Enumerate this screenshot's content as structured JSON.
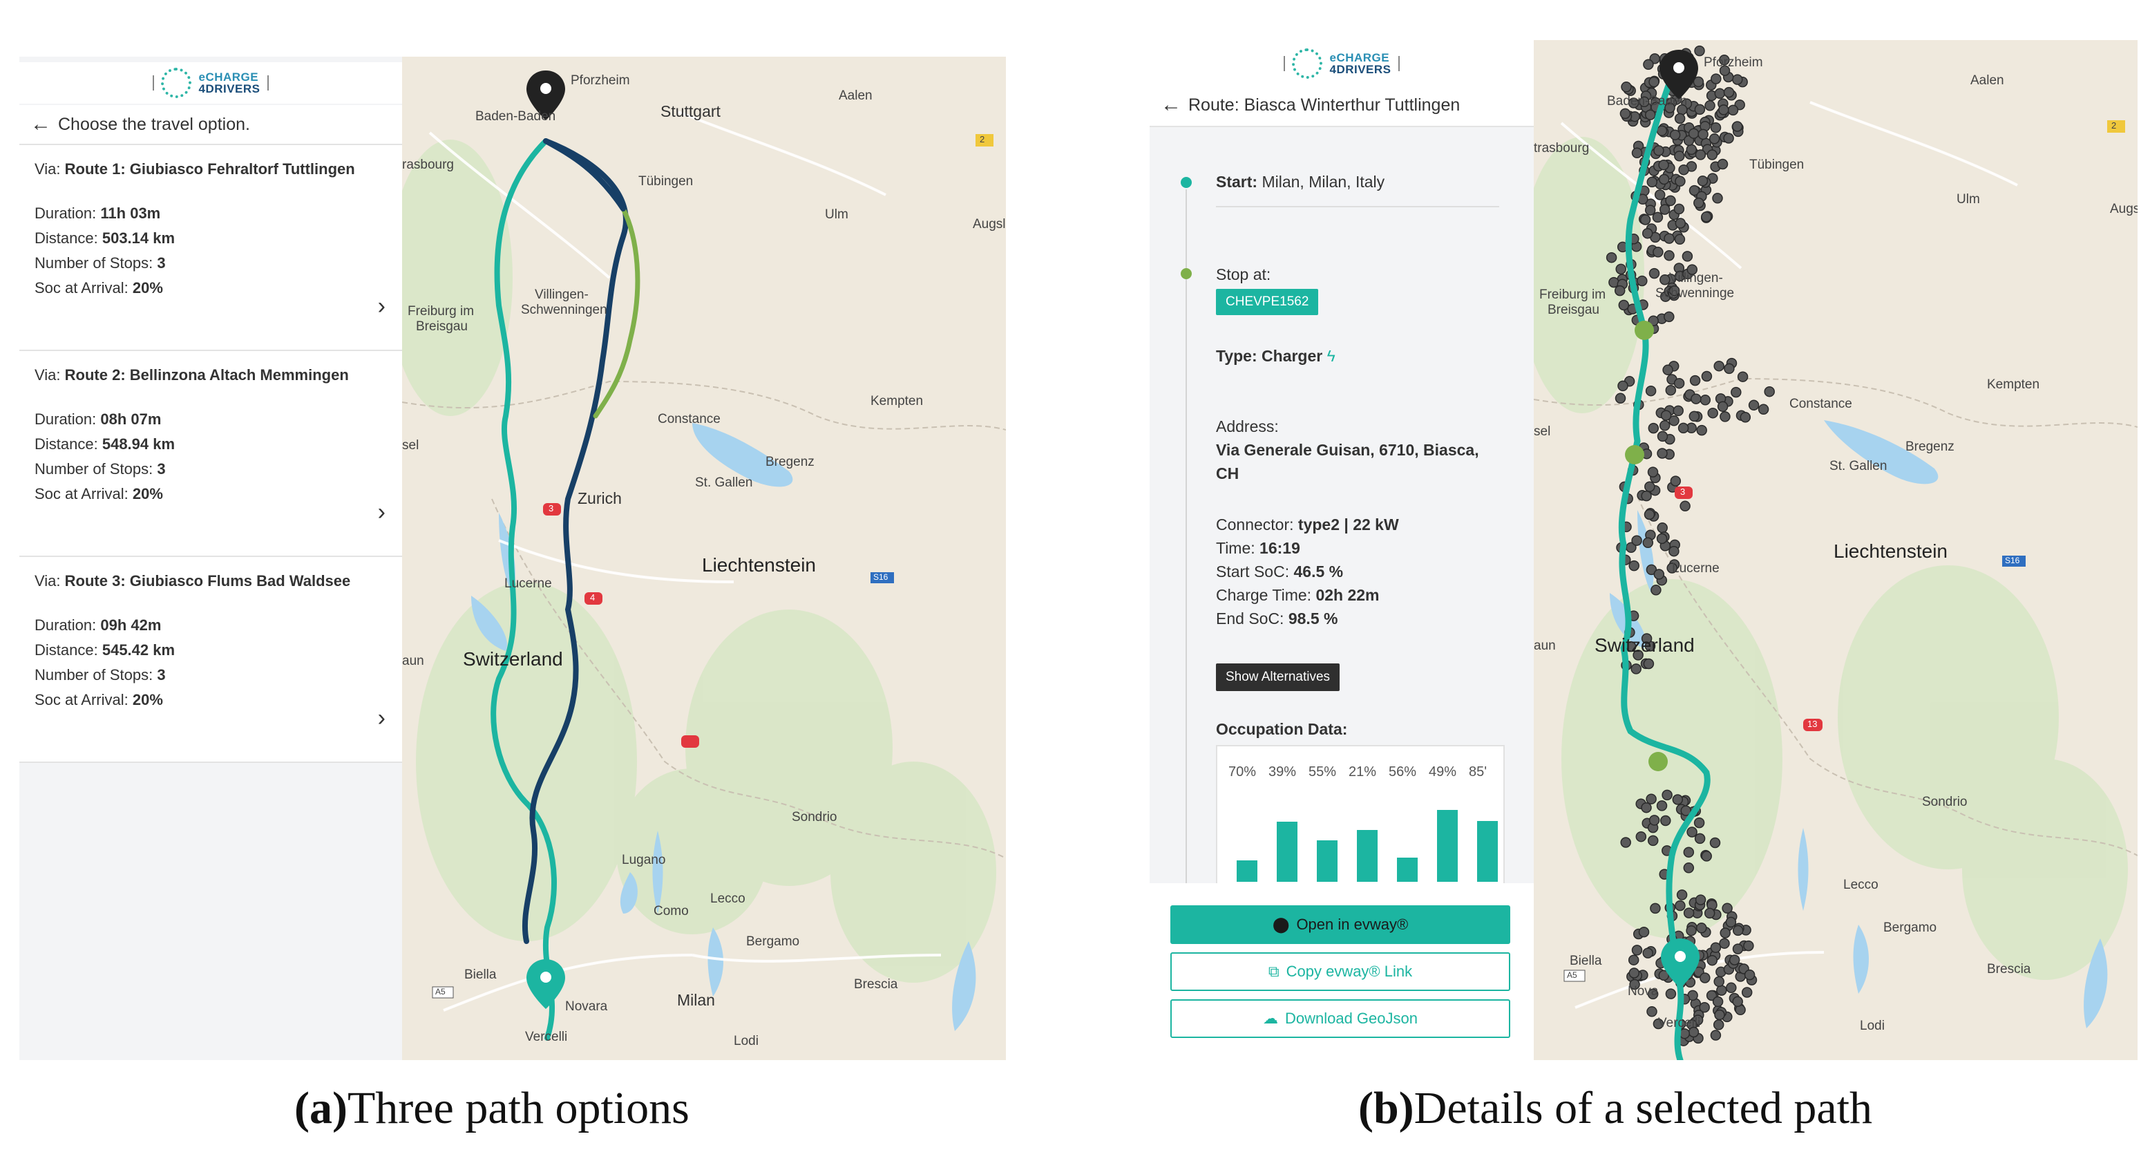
{
  "logo": {
    "line1": "eCHARGE",
    "line2": "4DRIVERS"
  },
  "panel_a": {
    "back_icon": "arrow-left-icon",
    "title": "Choose the travel option.",
    "routes": [
      {
        "via_prefix": "Via:",
        "name": "Route 1: Giubiasco Fehraltorf Tuttlingen",
        "duration_label": "Duration:",
        "duration": "11h 03m",
        "distance_label": "Distance:",
        "distance": "503.14 km",
        "stops_label": "Number of Stops:",
        "stops": "3",
        "soc_label": "Soc at Arrival:",
        "soc": "20%"
      },
      {
        "via_prefix": "Via:",
        "name": "Route 2: Bellinzona Altach Memmingen",
        "duration_label": "Duration:",
        "duration": "08h 07m",
        "distance_label": "Distance:",
        "distance": "548.94 km",
        "stops_label": "Number of Stops:",
        "stops": "3",
        "soc_label": "Soc at Arrival:",
        "soc": "20%"
      },
      {
        "via_prefix": "Via:",
        "name": "Route 3: Giubiasco Flums Bad Waldsee",
        "duration_label": "Duration:",
        "duration": "09h 42m",
        "distance_label": "Distance:",
        "distance": "545.42 km",
        "stops_label": "Number of Stops:",
        "stops": "3",
        "soc_label": "Soc at Arrival:",
        "soc": "20%"
      }
    ]
  },
  "panel_b": {
    "route_title": "Route: Biasca Winterthur Tuttlingen",
    "start_label": "Start:",
    "start_value": "Milan, Milan, Italy",
    "stop_label": "Stop at:",
    "stop_id": "CHEVPE1562",
    "type_label": "Type:",
    "type_value": "Charger",
    "address_label": "Address:",
    "address_line1": "Via Generale Guisan, 6710, Biasca,",
    "address_line2": "CH",
    "connector_label": "Connector:",
    "connector_value": "type2 | 22 kW",
    "time_label": "Time:",
    "time_value": "16:19",
    "start_soc_label": "Start SoC:",
    "start_soc_value": "46.5 %",
    "charge_time_label": "Charge Time:",
    "charge_time_value": "02h 22m",
    "end_soc_label": "End SoC:",
    "end_soc_value": "98.5 %",
    "show_alternatives": "Show Alternatives",
    "occupation_title": "Occupation Data:",
    "occupation": [
      {
        "label": "70%",
        "level": 0.3
      },
      {
        "label": "39%",
        "level": 0.84
      },
      {
        "label": "55%",
        "level": 0.58
      },
      {
        "label": "21%",
        "level": 0.72
      },
      {
        "label": "56%",
        "level": 0.34
      },
      {
        "label": "49%",
        "level": 1.0
      },
      {
        "label": "85'",
        "level": 0.85
      }
    ],
    "open_button": "Open in evway®",
    "copy_button": "Copy evway® Link",
    "download_button": "Download GeoJson"
  },
  "map_a_labels": {
    "pforzheim": "Pforzheim",
    "stuttgart": "Stuttgart",
    "aalen": "Aalen",
    "baden_baden": "Baden-Baden",
    "strasbourg": "rasbourg",
    "tubingen": "Tübingen",
    "ulm": "Ulm",
    "augsburg": "Augsl",
    "freiburg_1": "Freiburg im",
    "freiburg_2": "Breisgau",
    "villingen_1": "Villingen-",
    "villingen_2": "Schwenningen",
    "kempten": "Kempten",
    "constance": "Constance",
    "bregenz": "Bregenz",
    "st_gallen": "St. Gallen",
    "zurich": "Zurich",
    "liechtenstein": "Liechtenstein",
    "lucerne": "Lucerne",
    "switzerland": "Switzerland",
    "aun": "aun",
    "sel": "sel",
    "sondrio": "Sondrio",
    "lugano": "Lugano",
    "como": "Como",
    "lecco": "Lecco",
    "bergamo": "Bergamo",
    "biella": "Biella",
    "novara": "Novara",
    "milan": "Milan",
    "brescia": "Brescia",
    "vercelli": "Vercelli",
    "lodi": "Lodi",
    "shield_2": "2",
    "shield_3": "3",
    "shield_4": "4",
    "shield_a5": "A5",
    "shield_s16": "S16"
  },
  "map_b_labels": {
    "pforzheim": "Pforzheim",
    "aalen": "Aalen",
    "baden_baden": "Baden-Baden",
    "strasbourg": "trasbourg",
    "tubingen": "Tübingen",
    "ulm": "Ulm",
    "augsburg": "Augs",
    "freiburg_1": "Freiburg im",
    "freiburg_2": "Breisgau",
    "villingen_1": "Villingen-",
    "villingen_2": "Schwenninge",
    "kempten": "Kempten",
    "constance": "Constance",
    "bregenz": "Bregenz",
    "st_gallen": "St. Gallen",
    "liechtenstein": "Liechtenstein",
    "lucerne": "Lucerne",
    "switzerland": "Switzerland",
    "aun": "aun",
    "sel": "sel",
    "sondrio": "Sondrio",
    "lecco": "Lecco",
    "bergamo": "Bergamo",
    "biella": "Biella",
    "novara": "Nova",
    "brescia": "Brescia",
    "vercelli": "Vercelli",
    "lodi": "Lodi",
    "shield_2": "2",
    "shield_3": "3",
    "shield_13": "13",
    "shield_a5": "A5",
    "shield_s16": "S16"
  },
  "captions": {
    "a_letter": "(a)",
    "a_text": "Three path options",
    "b_letter": "(b)",
    "b_text": "Details of a selected path"
  },
  "colors": {
    "teal": "#1cb5a1",
    "navy": "#173f66",
    "green": "#7fb04a",
    "water": "#a7d3ef"
  }
}
